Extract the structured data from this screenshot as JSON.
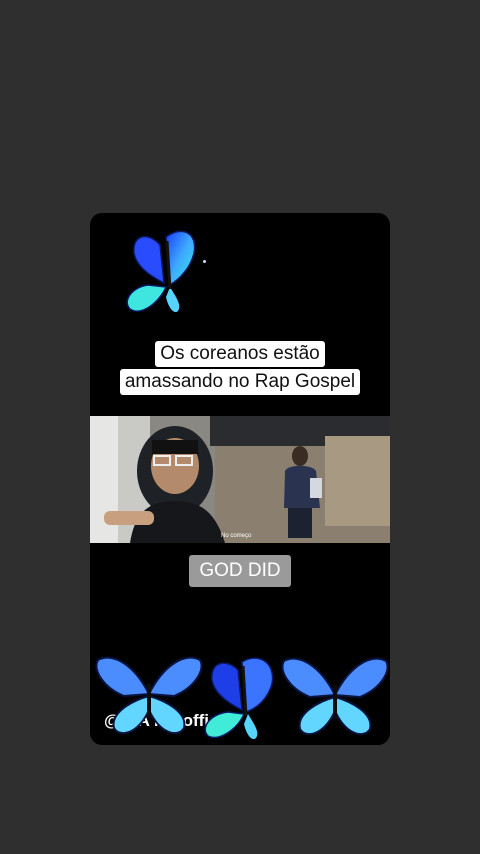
{
  "caption": {
    "line1": "Os coreanos estão",
    "line2": "amassando no Rap Gospel"
  },
  "video": {
    "subtitle": "No começo"
  },
  "badge": {
    "text": "GOD DID"
  },
  "watermark": {
    "text": "@ DA    NA    offic"
  },
  "icons": {
    "butterfly": "butterfly-icon"
  },
  "colors": {
    "background": "#2f2f2f",
    "card": "#000000",
    "badge": "#9a9a9a",
    "butterfly_blue": "#4fc3ff"
  }
}
